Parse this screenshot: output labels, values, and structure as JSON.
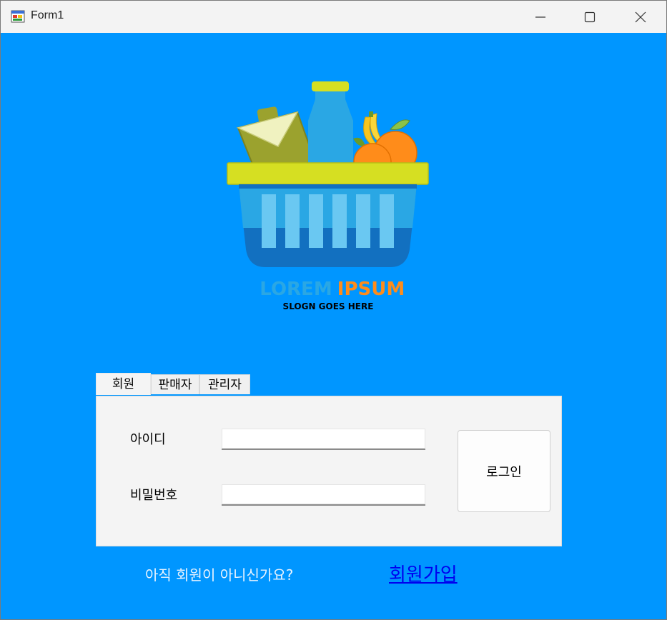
{
  "window": {
    "title": "Form1"
  },
  "logo": {
    "brand_word1": "LOREM",
    "brand_word2": "IPSUM",
    "slogan": "SLOGN GOES HERE"
  },
  "tabs": [
    {
      "label": "회원",
      "selected": true
    },
    {
      "label": "판매자",
      "selected": false
    },
    {
      "label": "관리자",
      "selected": false
    }
  ],
  "form": {
    "id_label": "아이디",
    "id_value": "",
    "password_label": "비밀번호",
    "password_value": "",
    "login_button": "로그인"
  },
  "footer": {
    "question": "아직 회원이 아니신가요?",
    "signup_link": "회원가입"
  },
  "colors": {
    "background": "#0096ff",
    "titlebar": "#f3f3f3",
    "link": "#0000ee",
    "logo_blue": "#2aa7e4",
    "logo_orange": "#ff8c1a",
    "logo_yellow": "#d6df22"
  }
}
